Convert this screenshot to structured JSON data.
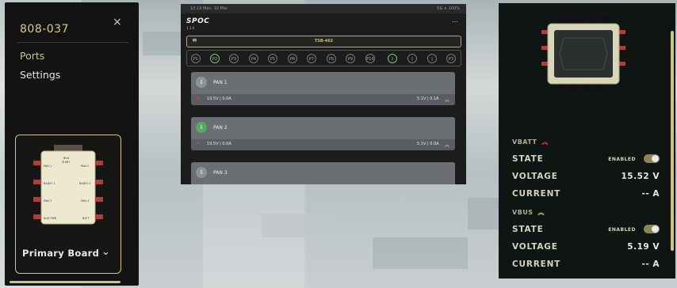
{
  "left_panel": {
    "device_title": "808-037",
    "close_icon": "×",
    "nav_items": [
      "Ports",
      "Settings"
    ],
    "board": {
      "name": "Primary Board",
      "chevron": "⌄",
      "labels": [
        "BUS",
        "SHIRT",
        "PAN 1",
        "PAN 2",
        "RADIO 1",
        "RADIO 2",
        "PAN 3",
        "PAN 4",
        "AUX PWR",
        "BATT"
      ]
    }
  },
  "middle_panel": {
    "status_time": "10:19   Mon, 10 Mar",
    "status_right": "5G ✦ 100%",
    "app_name": "SPOC",
    "app_version": "1.1.0",
    "menu_icon": "⋯",
    "device_name": "TSB-462",
    "ports": [
      "P1",
      "P2",
      "P3",
      "P4",
      "P5",
      "P6",
      "P7",
      "P8",
      "P9",
      "P10",
      "",
      "",
      "",
      "P3"
    ],
    "cards": [
      {
        "name": "PAN 1",
        "left": "19.5V | 0.0A",
        "right": "5.1V | 0.1A"
      },
      {
        "name": "PAN 2",
        "left": "19.5V | 0.0A",
        "right": "5.1V | 0.0A"
      },
      {
        "name": "PAN 3",
        "left": "",
        "right": ""
      }
    ]
  },
  "right_panel": {
    "vbatt": {
      "title": "VBATT",
      "state_label": "STATE",
      "state_value": "ENABLED",
      "voltage_label": "VOLTAGE",
      "voltage_value": "15.52 V",
      "current_label": "CURRENT",
      "current_value": "-- A"
    },
    "vbus": {
      "title": "VBUS",
      "state_label": "STATE",
      "state_value": "ENABLED",
      "voltage_label": "VOLTAGE",
      "voltage_value": "5.19 V",
      "current_label": "CURRENT",
      "current_value": "-- A"
    }
  },
  "colors": {
    "accent": "#cdc57b",
    "panel_bg": "#121312",
    "active_port": "#5fcf6b",
    "alert": "#d44444"
  }
}
